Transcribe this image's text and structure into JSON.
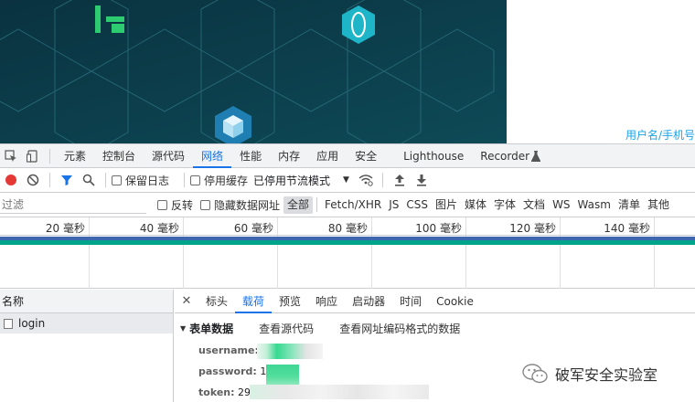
{
  "page": {
    "login_link": "用户名/手机号"
  },
  "devtools": {
    "panel_tabs": [
      "元素",
      "控制台",
      "源代码",
      "网络",
      "性能",
      "内存",
      "应用",
      "安全",
      "Lighthouse",
      "Recorder"
    ],
    "active_panel": "网络",
    "toolbar": {
      "preserve_log": "保留日志",
      "disable_cache": "停用缓存",
      "throttle": "已停用节流模式"
    },
    "filter": {
      "placeholder": "过滤",
      "invert": "反转",
      "hide_data_urls": "隐藏数据网址",
      "types": [
        "全部",
        "Fetch/XHR",
        "JS",
        "CSS",
        "图片",
        "媒体",
        "字体",
        "文档",
        "WS",
        "Wasm",
        "清单",
        "其他"
      ],
      "active_type": "全部"
    },
    "timeline": {
      "ticks": [
        "20 毫秒",
        "40 毫秒",
        "60 毫秒",
        "80 毫秒",
        "100 毫秒",
        "120 毫秒",
        "140 毫秒"
      ],
      "colors": {
        "bar_blue": "#3f67b1",
        "bar_teal": "#00a48a"
      }
    },
    "request_list": {
      "header": "名称",
      "rows": [
        {
          "name": "login"
        }
      ]
    },
    "detail_tabs": [
      "标头",
      "载荷",
      "预览",
      "响应",
      "启动器",
      "时间",
      "Cookie"
    ],
    "active_detail_tab": "载荷",
    "payload": {
      "section_title": "表单数据",
      "view_source": "查看源代码",
      "view_url_encoded": "查看网址编码格式的数据",
      "fields": [
        {
          "key": "username:",
          "value": ""
        },
        {
          "key": "password:",
          "value": "1"
        },
        {
          "key": "token:",
          "value": "29"
        }
      ]
    }
  },
  "watermark": {
    "text": "破军安全实验室"
  },
  "colors": {
    "accent": "#1a73e8",
    "record": "#e53935",
    "banner_bg": "#0b3a48"
  }
}
